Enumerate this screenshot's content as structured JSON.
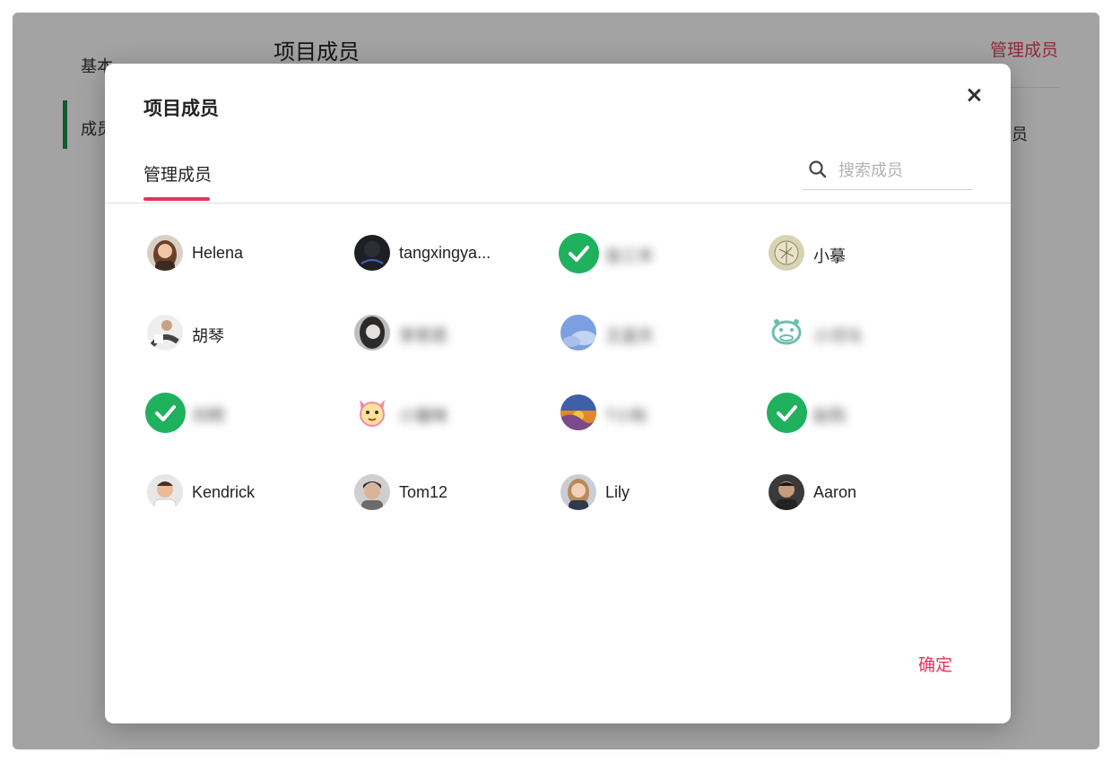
{
  "background": {
    "nav_basic": "基本",
    "nav_members": "成员",
    "page_title": "项目成员",
    "manage_link": "管理成员",
    "clipped_text": "员"
  },
  "modal": {
    "title": "项目成员",
    "tab_label": "管理成员",
    "search_placeholder": "搜索成员",
    "confirm_label": "确定"
  },
  "members": [
    {
      "name": "Helena",
      "selected": false,
      "avatar": "photo-woman-brown-hair"
    },
    {
      "name": "tangxingya...",
      "selected": false,
      "avatar": "dark-avatar"
    },
    {
      "name": "张三丰",
      "selected": true,
      "avatar": "check-icon",
      "blurred": true
    },
    {
      "name": "小摹",
      "selected": false,
      "avatar": "sketch-avatar"
    },
    {
      "name": "胡琴",
      "selected": false,
      "avatar": "photo-person-white"
    },
    {
      "name": "李思思",
      "selected": false,
      "avatar": "photo-woman-bw",
      "blurred": true
    },
    {
      "name": "王蓝天",
      "selected": false,
      "avatar": "sky-avatar",
      "blurred": true
    },
    {
      "name": "小河马",
      "selected": false,
      "avatar": "hippo-avatar",
      "blurred": true
    },
    {
      "name": "刘明",
      "selected": true,
      "avatar": "check-icon",
      "blurred": true
    },
    {
      "name": "小猫咪",
      "selected": false,
      "avatar": "cat-avatar",
      "blurred": true
    },
    {
      "name": "T小秋",
      "selected": false,
      "avatar": "painting-avatar",
      "blurred": true
    },
    {
      "name": "赵阳",
      "selected": true,
      "avatar": "check-icon",
      "blurred": true
    },
    {
      "name": "Kendrick",
      "selected": false,
      "avatar": "photo-man-smile"
    },
    {
      "name": "Tom12",
      "selected": false,
      "avatar": "photo-man-dark-hair"
    },
    {
      "name": "Lily",
      "selected": false,
      "avatar": "photo-woman-blonde"
    },
    {
      "name": "Aaron",
      "selected": false,
      "avatar": "photo-man-dark"
    }
  ],
  "colors": {
    "accent": "#e8325c",
    "selected_check": "#1fb15e",
    "nav_indicator": "#1d8f4e"
  }
}
